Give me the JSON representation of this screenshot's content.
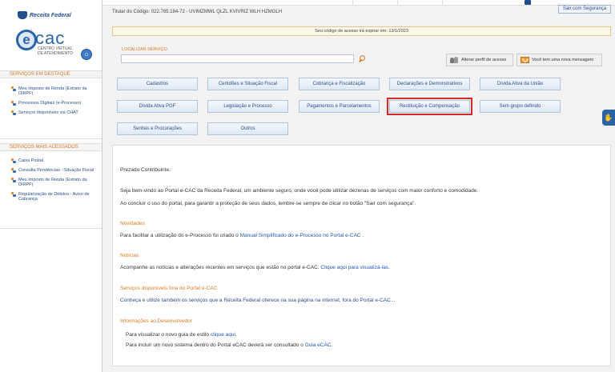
{
  "header": {
    "brand": "Receita Federal",
    "ecac": "cac",
    "ecac_e": "e",
    "ecac_subtitle": "CENTRO VIRTUAL DE ATENDIMENTO",
    "titular": "Titular do Código: 022.765.184-72 - UVIMZMWL QLZL KVIVRIZ WLH HZMGLH",
    "logout": "Sair com Segurança",
    "expire_notice": "Seu código de acesso irá expirar em: 13/1/2023",
    "search_label": "LOCALIZAR SERVIÇO",
    "search_value": "",
    "change_profile": "Alterar perfil de acesso",
    "messages": "Você tem uma nova mensagem"
  },
  "sidebar": {
    "featured_title": "SERVIÇOS EM DESTAQUE",
    "featured": [
      "Meu Imposto de Renda (Extrato da DIRPF)",
      "Processos Digitais (e-Processo)",
      "Serviços disponíveis via CHAT"
    ],
    "most_accessed_title": "SERVIÇOS MAIS ACESSADOS",
    "most_accessed": [
      "Caixa Postal",
      "Consulta Pendências - Situação Fiscal",
      "Meu Imposto de Renda (Extrato da DIRPF)",
      "Regularização de Débitos - Aviso de Cobrança"
    ]
  },
  "services": [
    "Cadastros",
    "Certidões e Situação Fiscal",
    "Cobrança e Fiscalização",
    "Declarações e Demonstrativos",
    "Dívida Ativa da União",
    "Dívida Ativa PGF",
    "Legislação e Processo",
    "Pagamentos e Parcelamentos",
    "Restituição e Compensação",
    "Sem grupo definido",
    "Senhas e Procurações",
    "Outros"
  ],
  "selected_service": "Restituição e Compensação",
  "welcome": {
    "greeting": "Prezado Contribuinte,",
    "line1": "Seja bem-vindo ao Portal e-CAC da Receita Federal, um ambiente seguro, onde você pode utilizar dezenas de serviços com maior conforto e comodidade.",
    "line2": "Ao concluir o uso do portal, para garantir a proteção de seus dados, lembre-se sempre de clicar no botão \"Sair com segurança\".",
    "novidades_title": "Novidades",
    "novidades_text": "Para facilitar a utilização do e-Processo foi criado o ",
    "novidades_link": "Manual Simplificado do e-Processo no Portal e-CAC",
    "novidades_end": " .",
    "noticias_title": "Notícias",
    "noticias_text": "Acompanhe as notícias e alterações recentes em serviços que estão no portal e-CAC. ",
    "noticias_link": "Clique aqui para visualizá-las",
    "noticias_end": ".",
    "fora_title": "Serviços disponíveis fora do Portal e-CAC",
    "fora_text": "Conheça e utilize também os serviços que a Receita Federal oferece na sua página na internet, fora do Portal e-CAC...",
    "dev_title": "Informações ao Desenvolvedor",
    "dev_line1_text": "Para visualizar o novo guia de estilo ",
    "dev_line1_link": "clique aqui",
    "dev_line1_end": ".",
    "dev_line2_text": "Para incluir um novo sistema dentro do Portal eCAC deverá ser consultado o ",
    "dev_line2_link": "Guia eCAC",
    "dev_line2_end": "."
  }
}
